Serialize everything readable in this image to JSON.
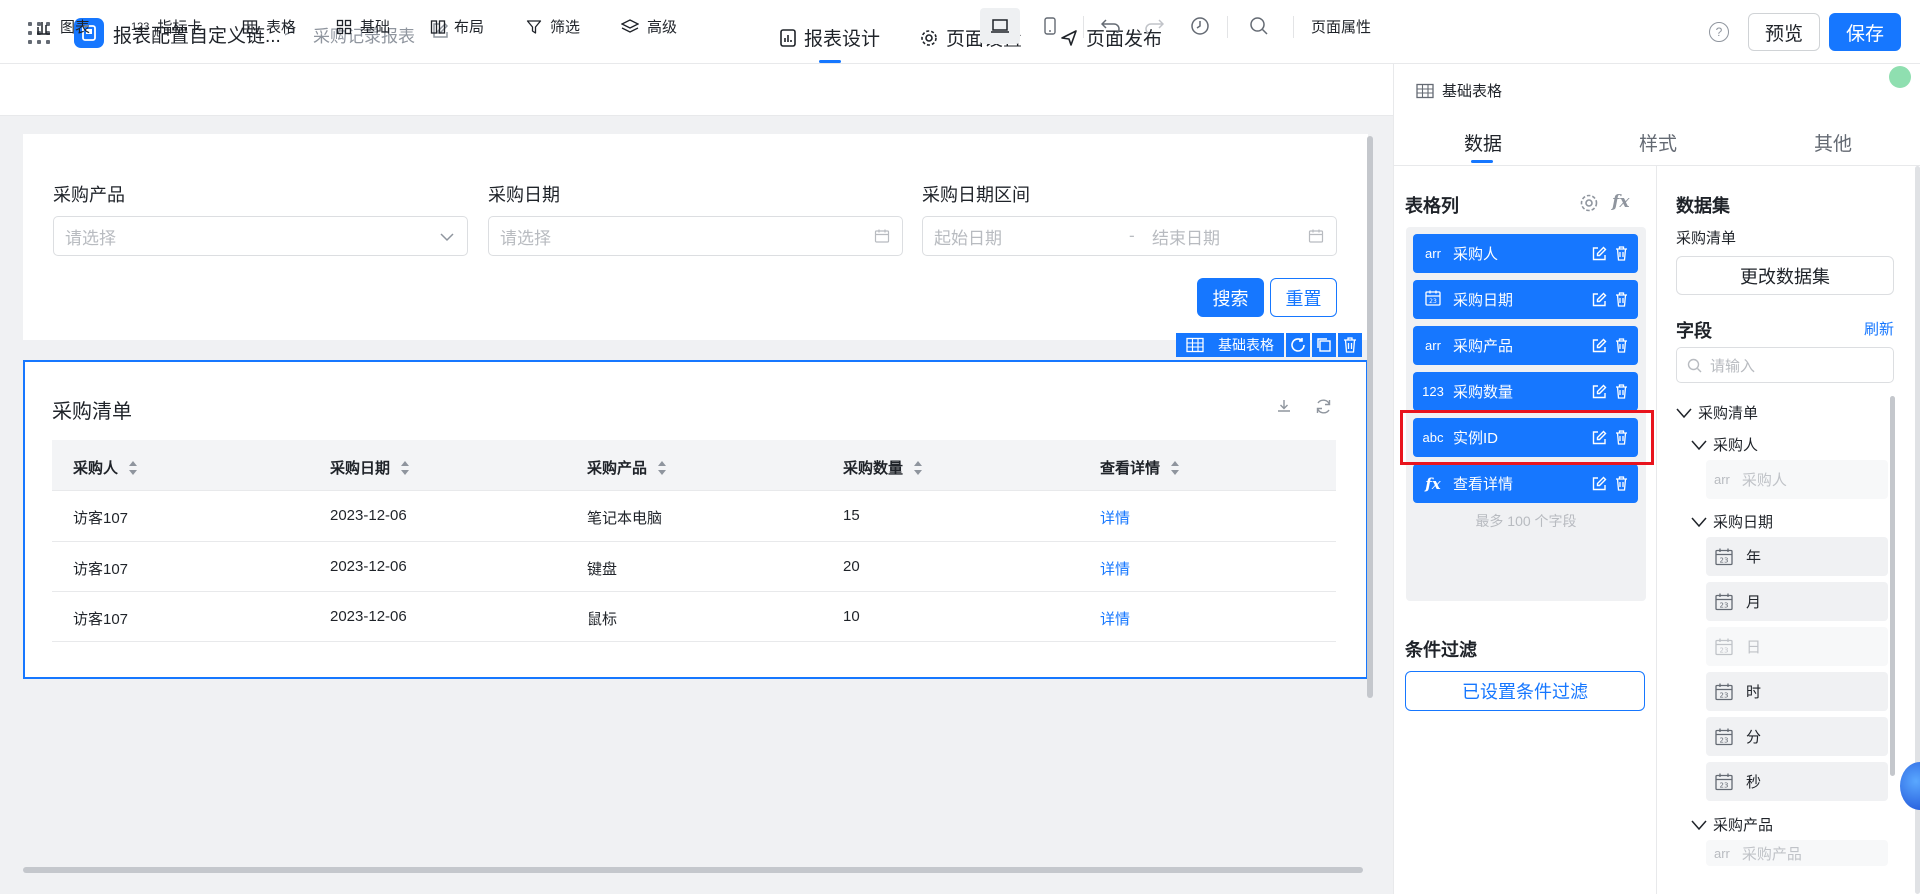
{
  "header": {
    "app_title": "报表配置自定义链...",
    "breadcrumb_sep": ">",
    "page_name": "采购记录报表",
    "tabs": [
      {
        "label": "报表设计",
        "icon": "report-design-icon"
      },
      {
        "label": "页面设置",
        "icon": "gear-icon"
      },
      {
        "label": "页面发布",
        "icon": "send-icon"
      }
    ],
    "help": "?",
    "preview_label": "预览",
    "save_label": "保存",
    "accent": "#1677ff"
  },
  "toolbar": {
    "items": [
      {
        "label": "图表",
        "icon": "bar-chart-icon"
      },
      {
        "label": "指标卡",
        "icon": "number-icon"
      },
      {
        "label": "表格",
        "icon": "table-icon"
      },
      {
        "label": "基础",
        "icon": "basic-icon"
      },
      {
        "label": "布局",
        "icon": "layout-icon"
      },
      {
        "label": "筛选",
        "icon": "filter-icon"
      },
      {
        "label": "高级",
        "icon": "layers-icon"
      }
    ],
    "page_props": "页面属性"
  },
  "filters": {
    "product_label": "采购产品",
    "product_placeholder": "请选择",
    "date_label": "采购日期",
    "date_placeholder": "请选择",
    "range_label": "采购日期区间",
    "range_start": "起始日期",
    "range_sep": "-",
    "range_end": "结束日期",
    "search_label": "搜索",
    "reset_label": "重置"
  },
  "selection": {
    "tag_label": "基础表格"
  },
  "table": {
    "title": "采购清单",
    "columns": [
      "采购人",
      "采购日期",
      "采购产品",
      "采购数量",
      "查看详情"
    ],
    "rows": [
      [
        "访客107",
        "2023-12-06",
        "笔记本电脑",
        "15",
        "详情"
      ],
      [
        "访客107",
        "2023-12-06",
        "键盘",
        "20",
        "详情"
      ],
      [
        "访客107",
        "2023-12-06",
        "鼠标",
        "10",
        "详情"
      ]
    ]
  },
  "panel": {
    "component_name": "基础表格",
    "tabs": [
      "数据",
      "样式",
      "其他"
    ],
    "columns_title": "表格列",
    "columns": [
      {
        "tag": "arr",
        "label": "采购人"
      },
      {
        "tag": "cal",
        "label": "采购日期"
      },
      {
        "tag": "arr",
        "label": "采购产品"
      },
      {
        "tag": "123",
        "label": "采购数量"
      },
      {
        "tag": "abc",
        "label": "实例ID"
      },
      {
        "tag": "fx",
        "label": "查看详情"
      }
    ],
    "max_note": "最多 100 个字段",
    "condition_title": "条件过滤",
    "condition_button": "已设置条件过滤",
    "dataset_title": "数据集",
    "dataset_name": "采购清单",
    "change_dataset": "更改数据集",
    "fields_title": "字段",
    "refresh": "刷新",
    "field_search_placeholder": "请输入",
    "tree": {
      "root": "采购清单",
      "group1": "采购人",
      "group1_leaf_tag": "arr",
      "group1_leaf": "采购人",
      "group2": "采购日期",
      "date_parts": [
        "年",
        "月",
        "日",
        "时",
        "分",
        "秒"
      ],
      "group3": "采购产品",
      "group3_leaf_tag": "arr",
      "group3_leaf": "采购产品"
    }
  }
}
